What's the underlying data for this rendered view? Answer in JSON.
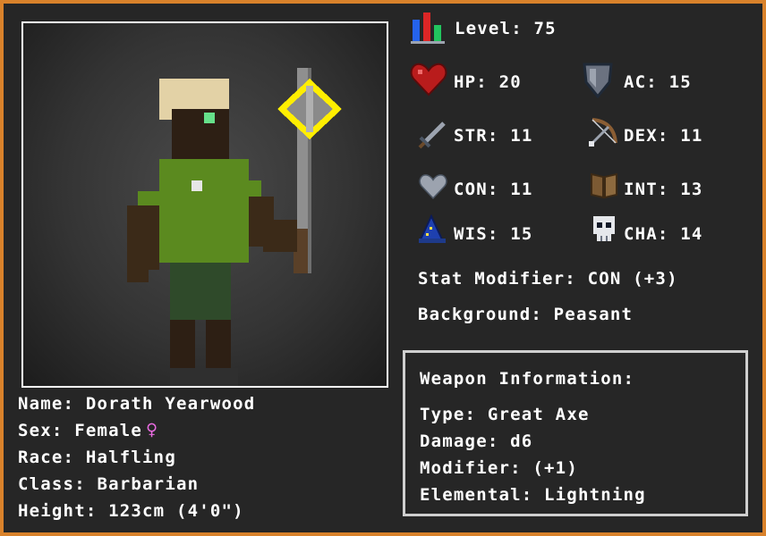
{
  "character": {
    "name_label": "Name:",
    "name": "Dorath Yearwood",
    "sex_label": "Sex:",
    "sex": "Female",
    "sex_symbol": "♀",
    "race_label": "Race:",
    "race": "Halfling",
    "class_label": "Class:",
    "class": "Barbarian",
    "height_label": "Height:",
    "height": "123cm (4'0\")"
  },
  "stats": {
    "level_label": "Level:",
    "level": "75",
    "hp_label": "HP:",
    "hp": "20",
    "ac_label": "AC:",
    "ac": "15",
    "str_label": "STR:",
    "str": "11",
    "dex_label": "DEX:",
    "dex": "11",
    "con_label": "CON:",
    "con": "11",
    "int_label": "INT:",
    "int": "13",
    "wis_label": "WIS:",
    "wis": "15",
    "cha_label": "CHA:",
    "cha": "14",
    "modifier_label": "Stat Modifier:",
    "modifier": "CON (+3)",
    "background_label": "Background:",
    "background": "Peasant"
  },
  "weapon": {
    "title": "Weapon Information:",
    "type_label": "Type:",
    "type": "Great Axe",
    "damage_label": "Damage:",
    "damage": "d6",
    "modifier_label": "Modifier:",
    "modifier": "(+1)",
    "elemental_label": "Elemental:",
    "elemental": "Lightning"
  },
  "colors": {
    "border": "#d9822b",
    "panel": "#262626",
    "text": "#ffffff",
    "female_symbol": "#e86be0",
    "elemental_glow": "#ffee00"
  },
  "icons": {
    "level": "level-bars-icon",
    "hp": "heart-icon",
    "ac": "shield-icon",
    "str": "sword-icon",
    "dex": "bow-icon",
    "con": "grey-heart-icon",
    "int": "book-icon",
    "wis": "wizard-hat-icon",
    "cha": "skull-icon"
  }
}
